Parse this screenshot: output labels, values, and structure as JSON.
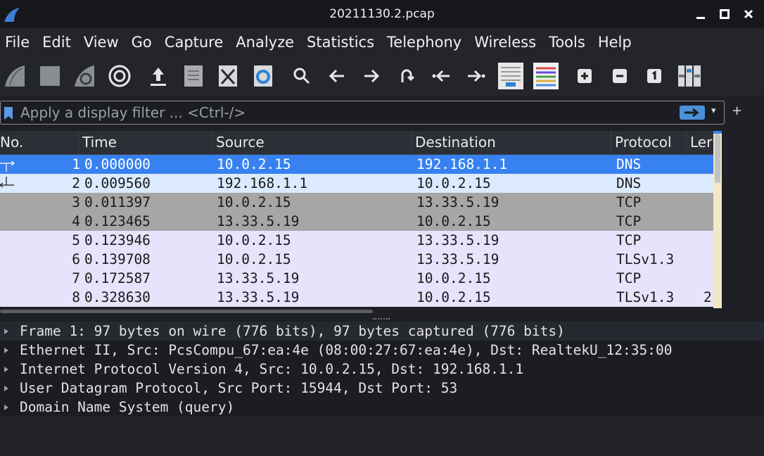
{
  "window": {
    "title": "20211130.2.pcap",
    "controls": [
      "minimize",
      "maximize",
      "close"
    ]
  },
  "menu": [
    "File",
    "Edit",
    "View",
    "Go",
    "Capture",
    "Analyze",
    "Statistics",
    "Telephony",
    "Wireless",
    "Tools",
    "Help"
  ],
  "toolbar": {
    "buttons": [
      "start-capture-icon",
      "stop-capture-icon",
      "restart-capture-icon",
      "capture-options-icon",
      "open-file-icon",
      "save-file-icon",
      "close-file-icon",
      "reload-file-icon",
      "find-packet-icon",
      "go-back-icon",
      "go-forward-icon",
      "go-to-packet-icon",
      "first-packet-icon",
      "last-packet-icon",
      "auto-scroll-icon",
      "colorize-icon",
      "zoom-in-icon",
      "zoom-out-icon",
      "normal-size-icon",
      "resize-columns-icon"
    ]
  },
  "filter": {
    "placeholder": "Apply a display filter ... <Ctrl-/>",
    "value": ""
  },
  "packet_list": {
    "columns": [
      "No.",
      "Time",
      "Source",
      "Destination",
      "Protocol",
      "Ler"
    ],
    "rows": [
      {
        "no": "1",
        "time": "0.000000",
        "source": "10.0.2.15",
        "destination": "192.168.1.1",
        "protocol": "DNS",
        "length": "",
        "style": "selected"
      },
      {
        "no": "2",
        "time": "0.009560",
        "source": "192.168.1.1",
        "destination": "10.0.2.15",
        "protocol": "DNS",
        "length": "",
        "style": "dns"
      },
      {
        "no": "3",
        "time": "0.011397",
        "source": "10.0.2.15",
        "destination": "13.33.5.19",
        "protocol": "TCP",
        "length": "",
        "style": "tcp-gray"
      },
      {
        "no": "4",
        "time": "0.123465",
        "source": "13.33.5.19",
        "destination": "10.0.2.15",
        "protocol": "TCP",
        "length": "",
        "style": "tcp-gray"
      },
      {
        "no": "5",
        "time": "0.123946",
        "source": "10.0.2.15",
        "destination": "13.33.5.19",
        "protocol": "TCP",
        "length": "",
        "style": "tcp"
      },
      {
        "no": "6",
        "time": "0.139708",
        "source": "10.0.2.15",
        "destination": "13.33.5.19",
        "protocol": "TLSv1.3",
        "length": "",
        "style": "tcp"
      },
      {
        "no": "7",
        "time": "0.172587",
        "source": "13.33.5.19",
        "destination": "10.0.2.15",
        "protocol": "TCP",
        "length": "",
        "style": "tcp"
      },
      {
        "no": "8",
        "time": "0.328630",
        "source": "13.33.5.19",
        "destination": "10.0.2.15",
        "protocol": "TLSv1.3",
        "length": "2",
        "style": "tcp"
      }
    ]
  },
  "details": [
    "Frame 1: 97 bytes on wire (776 bits), 97 bytes captured (776 bits)",
    "Ethernet II, Src: PcsCompu_67:ea:4e (08:00:27:67:ea:4e), Dst: RealtekU_12:35:00",
    "Internet Protocol Version 4, Src: 10.0.2.15, Dst: 192.168.1.1",
    "User Datagram Protocol, Src Port: 15944, Dst Port: 53",
    "Domain Name System (query)"
  ],
  "colors": {
    "selected_row": "#3781f0",
    "dns_row": "#dbeaff",
    "tcp_gray_row": "#a6a6a6",
    "tcp_row": "#e6e3fb",
    "accent": "#4a90d9"
  }
}
